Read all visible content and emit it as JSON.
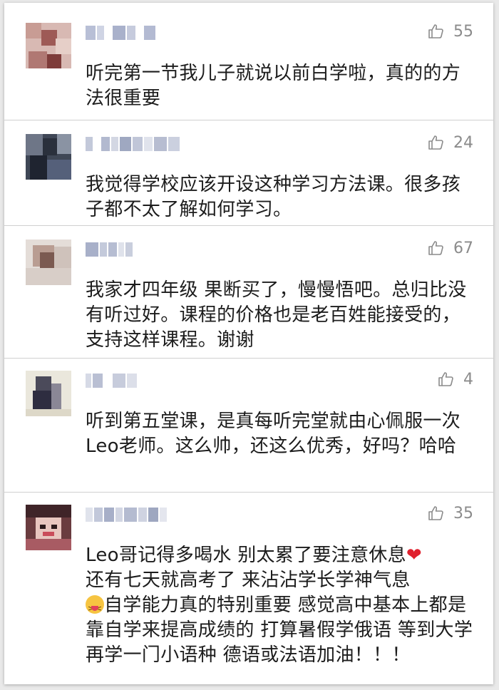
{
  "comments": [
    {
      "likes": "55",
      "text": "听完第一节我儿子就说以前白学啦，真的的方法很重要"
    },
    {
      "likes": "24",
      "text": "我觉得学校应该开设这种学习方法课。很多孩子都不太了解如何学习。"
    },
    {
      "likes": "67",
      "text": "我家才四年级 果断买了，慢慢悟吧。总归比没有听过好。课程的价格也是老百姓能接受的，支持这样课程。谢谢"
    },
    {
      "likes": "4",
      "text": "听到第五堂课，是真每听完堂就由心佩服一次Leo老师。这么帅，还这么优秀，好吗？哈哈"
    },
    {
      "likes": "35",
      "line1": "Leo哥记得多喝水 别太累了要注意休息",
      "line2": "还有七天就高考了 来沾沾学长学神气息",
      "line3": "自学能力真的特别重要 感觉高中基本上都是靠自学来提高成绩的 打算暑假学俄语 等到大学再学一门小语种 德语或法语加油！！！"
    }
  ],
  "icons": {
    "like": "thumbs-up-icon",
    "heart": "red-heart-emoji",
    "face": "tongue-face-emoji"
  },
  "colors": {
    "like": "#8b8b8b",
    "text": "#1c1c1c",
    "heart": "#e0202d"
  }
}
